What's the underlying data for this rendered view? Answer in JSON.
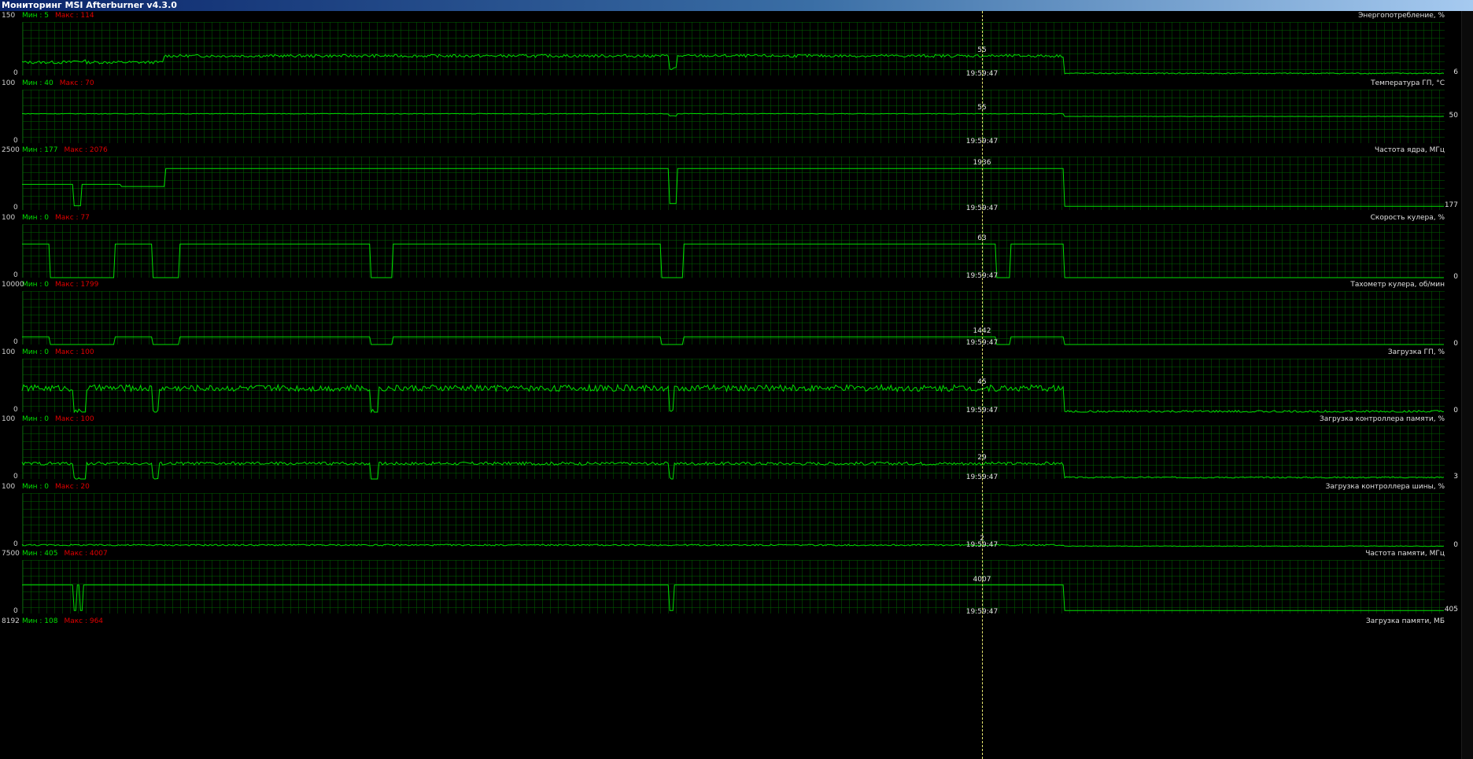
{
  "window": {
    "title": "Мониторинг MSI Afterburner v4.3.0"
  },
  "cursor": {
    "time": "19:59:47"
  },
  "labels": {
    "min_prefix": "Мин : ",
    "max_prefix": "Макс : "
  },
  "colors": {
    "line": "#00e000",
    "grid": "#005a00",
    "min_text": "#00e000",
    "max_text": "#e00000",
    "cursor": "#e8e870"
  },
  "graphs": [
    {
      "name": "Энергопотребление, %",
      "min": "5",
      "max": "114",
      "y_max": "150",
      "y_min": "0",
      "cursor_value": "55",
      "current_value": "6",
      "series": {
        "range": 150,
        "base": 55,
        "after": 6,
        "noise": 4,
        "dips": [
          [
            0.035,
            0.045,
            40
          ],
          [
            0.455,
            0.46,
            20
          ]
        ]
      }
    },
    {
      "name": "Температура ГП, °C",
      "min": "40",
      "max": "70",
      "y_max": "100",
      "y_min": "0",
      "cursor_value": "55",
      "current_value": "50",
      "series": {
        "range": 100,
        "base": 55,
        "after": 50,
        "noise": 0.6,
        "dips": [
          [
            0.455,
            0.46,
            51
          ]
        ]
      }
    },
    {
      "name": "Частота ядра, МГц",
      "min": "177",
      "max": "2076",
      "y_max": "2500",
      "y_min": "0",
      "cursor_value": "1936",
      "current_value": "177",
      "series": {
        "range": 2500,
        "base": 1936,
        "after": 177,
        "noise": 0,
        "dips": [
          [
            0.0,
            0.07,
            1200
          ],
          [
            0.036,
            0.042,
            200
          ],
          [
            0.07,
            0.1,
            1100
          ],
          [
            0.455,
            0.46,
            300
          ]
        ]
      }
    },
    {
      "name": "Скорость кулера, %",
      "min": "0",
      "max": "77",
      "y_max": "100",
      "y_min": "0",
      "cursor_value": "63",
      "current_value": "0",
      "series": {
        "range": 100,
        "base": 63,
        "after": 0,
        "noise": 0,
        "dips": [
          [
            0.02,
            0.065,
            0
          ],
          [
            0.092,
            0.11,
            0
          ],
          [
            0.245,
            0.26,
            0
          ],
          [
            0.45,
            0.465,
            0
          ],
          [
            0.685,
            0.695,
            0
          ]
        ]
      }
    },
    {
      "name": "Тахометр кулера, об/мин",
      "min": "0",
      "max": "1799",
      "y_max": "10000",
      "y_min": "0",
      "cursor_value": "1442",
      "current_value": "0",
      "series": {
        "range": 10000,
        "base": 1442,
        "after": 0,
        "noise": 0,
        "dips": [
          [
            0.02,
            0.065,
            0
          ],
          [
            0.092,
            0.11,
            0
          ],
          [
            0.245,
            0.26,
            0
          ],
          [
            0.45,
            0.465,
            0
          ],
          [
            0.685,
            0.695,
            0
          ]
        ]
      }
    },
    {
      "name": "Загрузка ГП, %",
      "min": "0",
      "max": "100",
      "y_max": "100",
      "y_min": "0",
      "cursor_value": "45",
      "current_value": "0",
      "series": {
        "range": 100,
        "base": 45,
        "after": 1,
        "noise": 6,
        "dips": [
          [
            0.036,
            0.045,
            0
          ],
          [
            0.092,
            0.096,
            0
          ],
          [
            0.245,
            0.25,
            0
          ],
          [
            0.455,
            0.458,
            0
          ]
        ]
      }
    },
    {
      "name": "Загрузка контроллера памяти, %",
      "min": "0",
      "max": "100",
      "y_max": "100",
      "y_min": "0",
      "cursor_value": "29",
      "current_value": "3",
      "series": {
        "range": 100,
        "base": 29,
        "after": 3,
        "noise": 3,
        "dips": [
          [
            0.036,
            0.045,
            0
          ],
          [
            0.092,
            0.096,
            0
          ],
          [
            0.245,
            0.25,
            0
          ],
          [
            0.455,
            0.458,
            0
          ]
        ]
      }
    },
    {
      "name": "Загрузка контроллера шины, %",
      "min": "0",
      "max": "20",
      "y_max": "100",
      "y_min": "0",
      "cursor_value": "2",
      "current_value": "0",
      "series": {
        "range": 100,
        "base": 3,
        "after": 1,
        "noise": 1.5,
        "dips": []
      }
    },
    {
      "name": "Частота памяти, МГц",
      "min": "405",
      "max": "4007",
      "y_max": "7500",
      "y_min": "0",
      "cursor_value": "4007",
      "current_value": "405",
      "series": {
        "range": 7500,
        "base": 4007,
        "after": 405,
        "noise": 0,
        "dips": [
          [
            0.036,
            0.038,
            405
          ],
          [
            0.041,
            0.043,
            405
          ],
          [
            0.455,
            0.458,
            405
          ]
        ]
      }
    },
    {
      "name": "Загрузка памяти, МБ",
      "min": "108",
      "max": "964",
      "y_max": "8192",
      "y_min": "",
      "cursor_value": "",
      "current_value": "",
      "series": null
    }
  ]
}
